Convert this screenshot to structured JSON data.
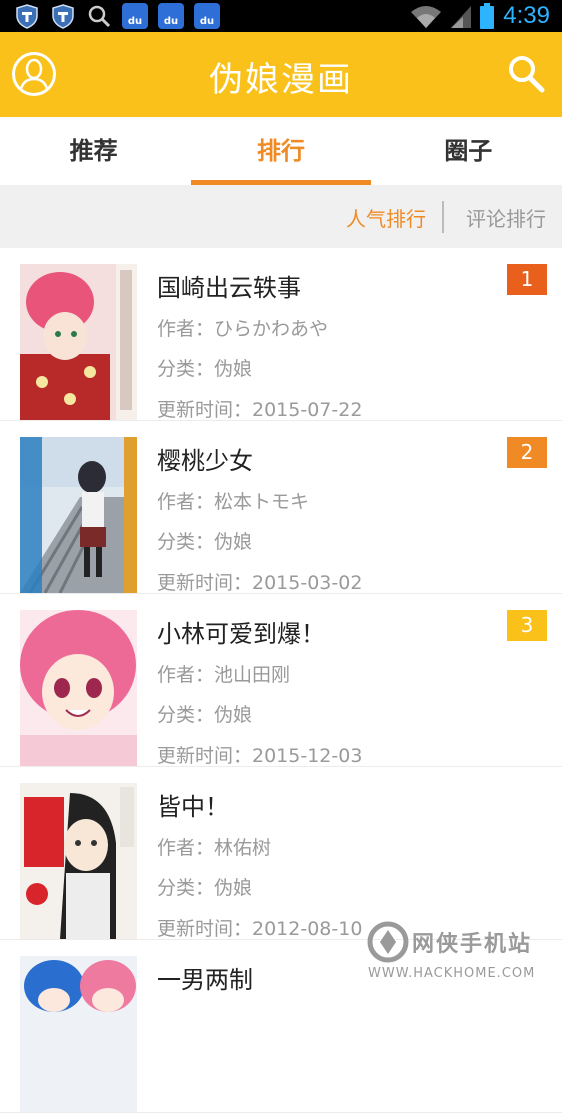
{
  "status_bar": {
    "time": "4:39",
    "icons": [
      "shield-icon",
      "shield-icon",
      "search-icon",
      "baidu-icon",
      "baidu-icon",
      "baidu-icon",
      "wifi-icon",
      "signal-icon",
      "battery-icon"
    ],
    "baidu_label": "du"
  },
  "app_bar": {
    "title": "伪娘漫画",
    "left_icon": "user-icon",
    "right_icon": "search-icon",
    "background": "#f9c11a"
  },
  "tabs": [
    {
      "label": "推荐",
      "active": false
    },
    {
      "label": "排行",
      "active": true
    },
    {
      "label": "圈子",
      "active": false
    }
  ],
  "sort": {
    "popular": "人气排行",
    "comment": "评论排行",
    "active_color": "#f08a24"
  },
  "items": [
    {
      "title": "国崎出云轶事",
      "author": "作者：ひらかわあや",
      "category": "分类：伪娘",
      "updated": "更新时间：2015-07-22",
      "rank": "1",
      "rank_color": "#e8601c"
    },
    {
      "title": "樱桃少女",
      "author": "作者：松本トモキ",
      "category": "分类：伪娘",
      "updated": "更新时间：2015-03-02",
      "rank": "2",
      "rank_color": "#f08a24"
    },
    {
      "title": "小林可爱到爆！",
      "author": "作者：池山田刚",
      "category": "分类：伪娘",
      "updated": "更新时间：2015-12-03",
      "rank": "3",
      "rank_color": "#f9c11a"
    },
    {
      "title": "皆中！",
      "author": "作者：林佑树",
      "category": "分类：伪娘",
      "updated": "更新时间：2012-08-10",
      "rank": "",
      "rank_color": ""
    },
    {
      "title": "一男两制",
      "author": "",
      "category": "",
      "updated": "",
      "rank": "",
      "rank_color": ""
    }
  ],
  "watermark": {
    "text": "网侠手机站",
    "url": "WWW.HACKHOME.COM"
  }
}
